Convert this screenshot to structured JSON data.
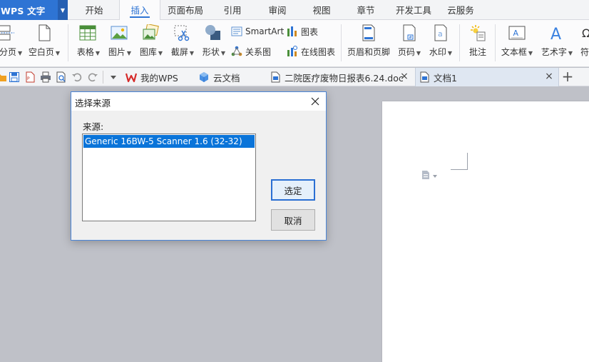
{
  "app": {
    "name": "WPS 文字"
  },
  "menu": {
    "tabs": [
      "开始",
      "插入",
      "页面布局",
      "引用",
      "审阅",
      "视图",
      "章节",
      "开发工具",
      "云服务"
    ],
    "active_index": 1
  },
  "ribbon": {
    "page_break": "分页",
    "blank_page": "空白页",
    "table": "表格",
    "picture": "图片",
    "gallery": "图库",
    "screenshot": "截屏",
    "shape": "形状",
    "smartart": "SmartArt",
    "chart": "图表",
    "relation_chart": "关系图",
    "online_chart": "在线图表",
    "header_footer": "页眉和页脚",
    "page_number": "页码",
    "watermark": "水印",
    "comment": "批注",
    "textbox": "文本框",
    "wordart": "艺术字",
    "symbol_partial": "符"
  },
  "doc_tabs": [
    {
      "label": "我的WPS",
      "icon": "wps-logo-icon"
    },
    {
      "label": "云文档",
      "icon": "cloud-cube-icon"
    },
    {
      "label": "二院医疗废物日报表6.24.doc",
      "icon": "word-doc-icon"
    },
    {
      "label": "文档1",
      "icon": "word-doc-icon",
      "active": true
    }
  ],
  "dialog": {
    "title": "选择来源",
    "source_label": "来源:",
    "sources": [
      "Generic 16BW-5 Scanner 1.6 (32-32)"
    ],
    "select_button": "选定",
    "cancel_button": "取消"
  },
  "colors": {
    "accent": "#2e74d4",
    "selection": "#0a74d9",
    "workspace": "#bfc1c8"
  }
}
